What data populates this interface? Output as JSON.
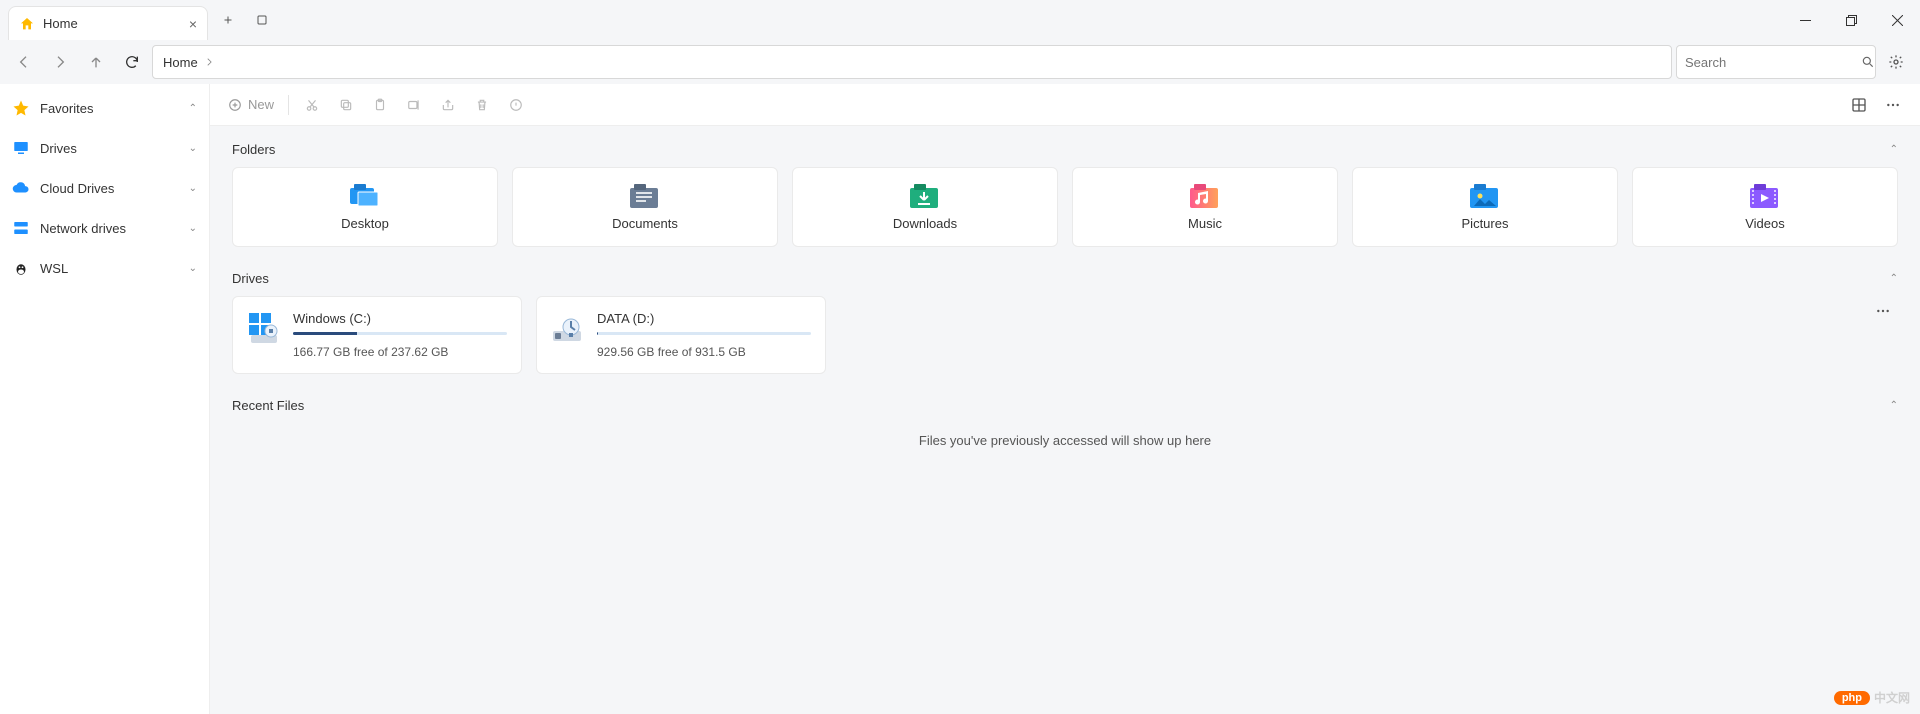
{
  "window": {
    "tab_title": "Home",
    "new_tab_tooltip": "New tab"
  },
  "nav": {
    "breadcrumb": "Home",
    "search_placeholder": "Search"
  },
  "sidebar": {
    "items": [
      {
        "label": "Favorites",
        "icon": "star",
        "expanded": true
      },
      {
        "label": "Drives",
        "icon": "monitor",
        "expanded": false
      },
      {
        "label": "Cloud Drives",
        "icon": "cloud",
        "expanded": false
      },
      {
        "label": "Network drives",
        "icon": "network",
        "expanded": false
      },
      {
        "label": "WSL",
        "icon": "linux",
        "expanded": false
      }
    ]
  },
  "toolbar": {
    "new_label": "New"
  },
  "sections": {
    "folders": {
      "title": "Folders",
      "items": [
        {
          "label": "Desktop",
          "type": "desktop"
        },
        {
          "label": "Documents",
          "type": "documents"
        },
        {
          "label": "Downloads",
          "type": "downloads"
        },
        {
          "label": "Music",
          "type": "music"
        },
        {
          "label": "Pictures",
          "type": "pictures"
        },
        {
          "label": "Videos",
          "type": "videos"
        }
      ]
    },
    "drives": {
      "title": "Drives",
      "items": [
        {
          "name": "Windows (C:)",
          "free_text": "166.77 GB free of 237.62 GB",
          "used_pct": 30
        },
        {
          "name": "DATA (D:)",
          "free_text": "929.56 GB free of 931.5 GB",
          "used_pct": 0.2
        }
      ]
    },
    "recent": {
      "title": "Recent Files",
      "empty_text": "Files you've previously accessed will show up here"
    }
  },
  "watermark": {
    "badge": "php",
    "text": "中文网"
  }
}
